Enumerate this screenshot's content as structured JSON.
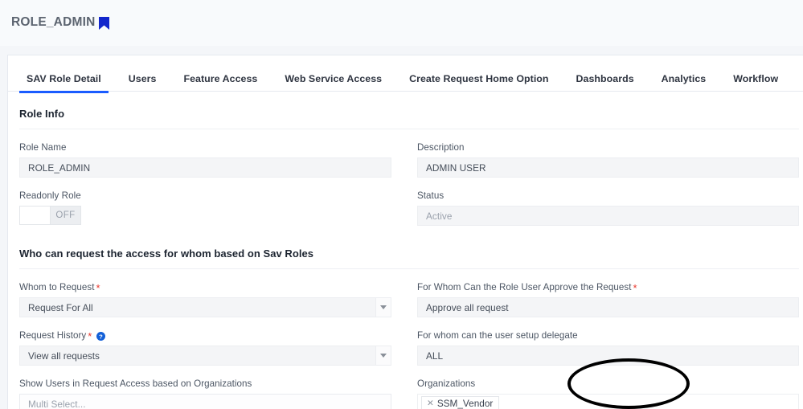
{
  "header": {
    "title": "ROLE_ADMIN",
    "bookmark_icon": "bookmark-icon",
    "bookmark_color": "#1226cc"
  },
  "tabs": {
    "active_index": 0,
    "accent_color": "#1a5cff",
    "items": [
      {
        "label": "SAV Role Detail"
      },
      {
        "label": "Users"
      },
      {
        "label": "Feature Access"
      },
      {
        "label": "Web Service Access"
      },
      {
        "label": "Create Request Home Option"
      },
      {
        "label": "Dashboards"
      },
      {
        "label": "Analytics"
      },
      {
        "label": "Workflow"
      }
    ]
  },
  "sections": [
    {
      "title": "Role Info",
      "fields": {
        "role_name": {
          "label": "Role Name",
          "value": "ROLE_ADMIN"
        },
        "description": {
          "label": "Description",
          "value": "ADMIN USER"
        },
        "readonly_role": {
          "label": "Readonly Role",
          "state_label": "OFF",
          "state": "off"
        },
        "status": {
          "label": "Status",
          "value": "Active"
        }
      }
    },
    {
      "title": "Who can request the access for whom based on Sav Roles",
      "fields": {
        "whom_to_request": {
          "label": "Whom to Request",
          "required": true,
          "value": "Request For All"
        },
        "approve_request": {
          "label": "For Whom Can the Role User Approve the Request",
          "required": true,
          "value": "Approve all request"
        },
        "request_history": {
          "label": "Request History",
          "required": true,
          "help_icon": "help-circle-icon",
          "value": "View all requests"
        },
        "setup_delegate": {
          "label": "For whom can the user setup delegate",
          "value": "ALL"
        },
        "show_users_orgs": {
          "label": "Show Users in Request Access based on Organizations",
          "placeholder": "Multi Select..."
        },
        "organizations": {
          "label": "Organizations",
          "chips": [
            {
              "label": "SSM_Vendor",
              "remove_icon": "close-icon"
            }
          ]
        }
      }
    }
  ],
  "annotation": {
    "shape": "oval-highlight",
    "color": "#000000"
  },
  "required_marker": "*"
}
